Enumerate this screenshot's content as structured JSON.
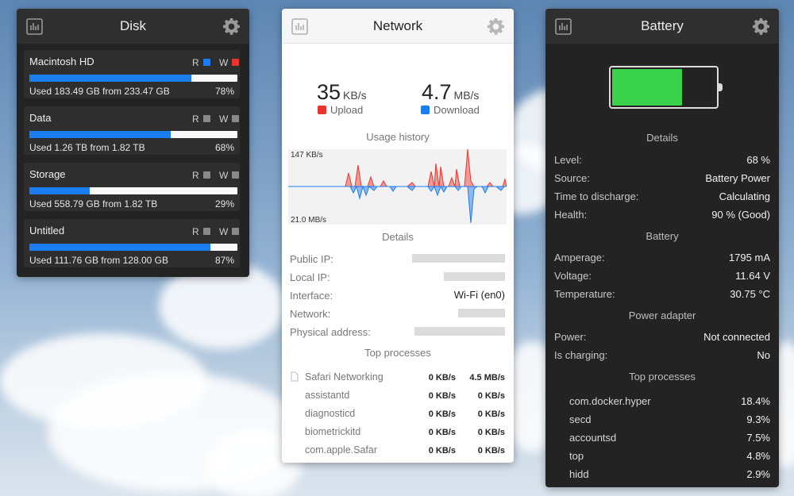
{
  "disk": {
    "title": "Disk",
    "drives": [
      {
        "name": "Macintosh HD",
        "r": "R",
        "w": "W",
        "r_color": "#1a7df0",
        "w_color": "#e8362e",
        "used_text": "Used 183.49 GB from 233.47 GB",
        "percent_text": "78%",
        "usage": 0.78
      },
      {
        "name": "Data",
        "r": "R",
        "w": "W",
        "r_color": "#8a8a8a",
        "w_color": "#8a8a8a",
        "used_text": "Used 1.26 TB from 1.82 TB",
        "percent_text": "68%",
        "usage": 0.68
      },
      {
        "name": "Storage",
        "r": "R",
        "w": "W",
        "r_color": "#8a8a8a",
        "w_color": "#8a8a8a",
        "used_text": "Used 558.79 GB from 1.82 TB",
        "percent_text": "29%",
        "usage": 0.29
      },
      {
        "name": "Untitled",
        "r": "R",
        "w": "W",
        "r_color": "#8a8a8a",
        "w_color": "#8a8a8a",
        "used_text": "Used 111.76 GB from 128.00 GB",
        "percent_text": "87%",
        "usage": 0.87
      }
    ]
  },
  "network": {
    "title": "Network",
    "upload_value": "35",
    "upload_unit": "KB/s",
    "upload_label": "Upload",
    "download_value": "4.7",
    "download_unit": "MB/s",
    "download_label": "Download",
    "upload_color": "#e8362e",
    "download_color": "#1a7df0",
    "usage_history_title": "Usage history",
    "chart_top_label": "147 KB/s",
    "chart_bottom_label": "21.0 MB/s",
    "details_title": "Details",
    "details": [
      {
        "key": "Public IP:",
        "value": ""
      },
      {
        "key": "Local IP:",
        "value": ""
      },
      {
        "key": "Interface:",
        "value": "Wi-Fi (en0)"
      },
      {
        "key": "Network:",
        "value": ""
      },
      {
        "key": "Physical address:",
        "value": ""
      }
    ],
    "top_processes_title": "Top processes",
    "processes": [
      {
        "name": "Safari Networking",
        "up": "0 KB/s",
        "down": "4.5 MB/s"
      },
      {
        "name": "assistantd",
        "up": "0 KB/s",
        "down": "0 KB/s"
      },
      {
        "name": "diagnosticd",
        "up": "0 KB/s",
        "down": "0 KB/s"
      },
      {
        "name": "biometrickitd",
        "up": "0 KB/s",
        "down": "0 KB/s"
      },
      {
        "name": "com.apple.Safar",
        "up": "0 KB/s",
        "down": "0 KB/s"
      }
    ]
  },
  "battery": {
    "title": "Battery",
    "level": 0.68,
    "level_color": "#3ad24a",
    "details_title": "Details",
    "details": [
      {
        "key": "Level:",
        "value": "68 %"
      },
      {
        "key": "Source:",
        "value": "Battery Power"
      },
      {
        "key": "Time to discharge:",
        "value": "Calculating"
      },
      {
        "key": "Health:",
        "value": "90 % (Good)"
      }
    ],
    "battery_title": "Battery",
    "battery_info": [
      {
        "key": "Amperage:",
        "value": "1795 mA"
      },
      {
        "key": "Voltage:",
        "value": "11.64 V"
      },
      {
        "key": "Temperature:",
        "value": "30.75 °C"
      }
    ],
    "adapter_title": "Power adapter",
    "adapter_info": [
      {
        "key": "Power:",
        "value": "Not connected"
      },
      {
        "key": "Is charging:",
        "value": "No"
      }
    ],
    "top_processes_title": "Top processes",
    "processes": [
      {
        "name": "com.docker.hyper",
        "value": "18.4%"
      },
      {
        "name": "secd",
        "value": "9.3%"
      },
      {
        "name": "accountsd",
        "value": "7.5%"
      },
      {
        "name": "top",
        "value": "4.8%"
      },
      {
        "name": "hidd",
        "value": "2.9%"
      }
    ]
  }
}
